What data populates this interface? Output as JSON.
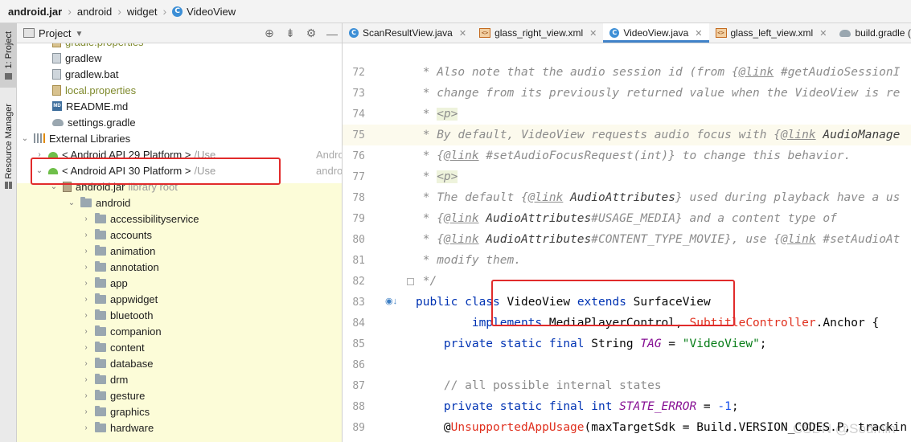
{
  "breadcrumb": [
    "android.jar",
    "android",
    "widget",
    "VideoView"
  ],
  "toolwindows": {
    "project": "1: Project",
    "resource_manager": "Resource Manager"
  },
  "project_panel": {
    "title": "Project",
    "tree": [
      {
        "label": "gradle.properties",
        "kind": "props",
        "depth": 2
      },
      {
        "label": "gradlew",
        "kind": "file",
        "depth": 2
      },
      {
        "label": "gradlew.bat",
        "kind": "file",
        "depth": 2
      },
      {
        "label": "local.properties",
        "kind": "props",
        "depth": 2
      },
      {
        "label": "README.md",
        "kind": "md",
        "depth": 2
      },
      {
        "label": "settings.gradle",
        "kind": "gradle",
        "depth": 2
      },
      {
        "label": "External Libraries",
        "kind": "lib",
        "depth": 0,
        "expanded": true
      },
      {
        "label": "< Android API 29 Platform >",
        "suffix": "/Use",
        "right": "Andro",
        "kind": "android",
        "depth": 1,
        "expanded": false
      },
      {
        "label": "< Android API 30 Platform >",
        "suffix": "/Use",
        "right": "andro",
        "kind": "android",
        "depth": 1,
        "expanded": true
      },
      {
        "label": "android.jar",
        "suffix": "library root",
        "kind": "jar",
        "depth": 2,
        "expanded": true
      },
      {
        "label": "android",
        "kind": "folder",
        "depth": 3,
        "expanded": true
      },
      {
        "label": "accessibilityservice",
        "kind": "folder",
        "depth": 4
      },
      {
        "label": "accounts",
        "kind": "folder",
        "depth": 4
      },
      {
        "label": "animation",
        "kind": "folder",
        "depth": 4
      },
      {
        "label": "annotation",
        "kind": "folder",
        "depth": 4
      },
      {
        "label": "app",
        "kind": "folder",
        "depth": 4
      },
      {
        "label": "appwidget",
        "kind": "folder",
        "depth": 4
      },
      {
        "label": "bluetooth",
        "kind": "folder",
        "depth": 4
      },
      {
        "label": "companion",
        "kind": "folder",
        "depth": 4
      },
      {
        "label": "content",
        "kind": "folder",
        "depth": 4
      },
      {
        "label": "database",
        "kind": "folder",
        "depth": 4
      },
      {
        "label": "drm",
        "kind": "folder",
        "depth": 4
      },
      {
        "label": "gesture",
        "kind": "folder",
        "depth": 4
      },
      {
        "label": "graphics",
        "kind": "folder",
        "depth": 4
      },
      {
        "label": "hardware",
        "kind": "folder",
        "depth": 4
      }
    ]
  },
  "tabs": [
    {
      "label": "ScanResultView.java",
      "icon": "java",
      "active": false
    },
    {
      "label": "glass_right_view.xml",
      "icon": "xml",
      "active": false
    },
    {
      "label": "VideoView.java",
      "icon": "java",
      "active": true
    },
    {
      "label": "glass_left_view.xml",
      "icon": "xml",
      "active": false
    },
    {
      "label": "build.gradle (:k",
      "icon": "gradle",
      "active": false
    }
  ],
  "editor": {
    "current_line": 75,
    "lines": [
      {
        "n": 72,
        "segs": [
          [
            "doc",
            " * Also note that the audio session id (from {"
          ],
          [
            "tag",
            "@link"
          ],
          [
            "doc",
            " #getAudioSessionI"
          ]
        ]
      },
      {
        "n": 73,
        "segs": [
          [
            "doc",
            " * change from its previously returned value when the VideoView is re"
          ]
        ]
      },
      {
        "n": 74,
        "segs": [
          [
            "doc",
            " * "
          ],
          [
            "html",
            "<p>"
          ]
        ]
      },
      {
        "n": 75,
        "segs": [
          [
            "doc",
            " * By default, VideoView requests audio focus with {"
          ],
          [
            "tag",
            "@link"
          ],
          [
            "ref",
            " AudioManage"
          ]
        ]
      },
      {
        "n": 76,
        "segs": [
          [
            "doc",
            " * {"
          ],
          [
            "tag",
            "@link"
          ],
          [
            "doc",
            " #setAudioFocusRequest(int)} to change this behavior."
          ]
        ]
      },
      {
        "n": 77,
        "segs": [
          [
            "doc",
            " * "
          ],
          [
            "html",
            "<p>"
          ]
        ]
      },
      {
        "n": 78,
        "segs": [
          [
            "doc",
            " * The default {"
          ],
          [
            "tag",
            "@link"
          ],
          [
            "ref",
            " AudioAttributes"
          ],
          [
            "doc",
            "} used during playback have a us"
          ]
        ]
      },
      {
        "n": 79,
        "segs": [
          [
            "doc",
            " * {"
          ],
          [
            "tag",
            "@link"
          ],
          [
            "ref",
            " AudioAttributes"
          ],
          [
            "doc",
            "#USAGE_MEDIA} and a content type of"
          ]
        ]
      },
      {
        "n": 80,
        "segs": [
          [
            "doc",
            " * {"
          ],
          [
            "tag",
            "@link"
          ],
          [
            "ref",
            " AudioAttributes"
          ],
          [
            "doc",
            "#CONTENT_TYPE_MOVIE}, use {"
          ],
          [
            "tag",
            "@link"
          ],
          [
            "doc",
            " #setAudioAt"
          ]
        ]
      },
      {
        "n": 81,
        "segs": [
          [
            "doc",
            " * modify them."
          ]
        ]
      },
      {
        "n": 82,
        "segs": [
          [
            "doc",
            " */"
          ]
        ]
      },
      {
        "n": 83,
        "segs": [
          [
            "kw",
            "public class "
          ],
          [
            "plain",
            "VideoView "
          ],
          [
            "kw",
            "extends "
          ],
          [
            "plain",
            "SurfaceView"
          ]
        ]
      },
      {
        "n": 84,
        "segs": [
          [
            "plain",
            "        "
          ],
          [
            "kw",
            "implements "
          ],
          [
            "plain",
            "MediaPlayerControl, "
          ],
          [
            "red",
            "SubtitleController"
          ],
          [
            "plain",
            ".Anchor {"
          ]
        ]
      },
      {
        "n": 85,
        "segs": [
          [
            "plain",
            "    "
          ],
          [
            "kw",
            "private static final "
          ],
          [
            "plain",
            "String "
          ],
          [
            "const",
            "TAG"
          ],
          [
            "plain",
            " = "
          ],
          [
            "str",
            "\"VideoView\""
          ],
          [
            "plain",
            ";"
          ]
        ]
      },
      {
        "n": 86,
        "segs": []
      },
      {
        "n": 87,
        "segs": [
          [
            "plain",
            "    "
          ],
          [
            "cmt",
            "// all possible internal states"
          ]
        ]
      },
      {
        "n": 88,
        "segs": [
          [
            "plain",
            "    "
          ],
          [
            "kw",
            "private static final int "
          ],
          [
            "const",
            "STATE_ERROR"
          ],
          [
            "plain",
            " = "
          ],
          [
            "num",
            "-1"
          ],
          [
            "plain",
            ";"
          ]
        ]
      },
      {
        "n": 89,
        "segs": [
          [
            "plain",
            "    @"
          ],
          [
            "red",
            "UnsupportedAppUsage"
          ],
          [
            "plain",
            "(maxTargetSdk = Build.VERSION_CODES.P, trackin"
          ]
        ]
      }
    ]
  },
  "watermark": "CSDN @Sodmin"
}
